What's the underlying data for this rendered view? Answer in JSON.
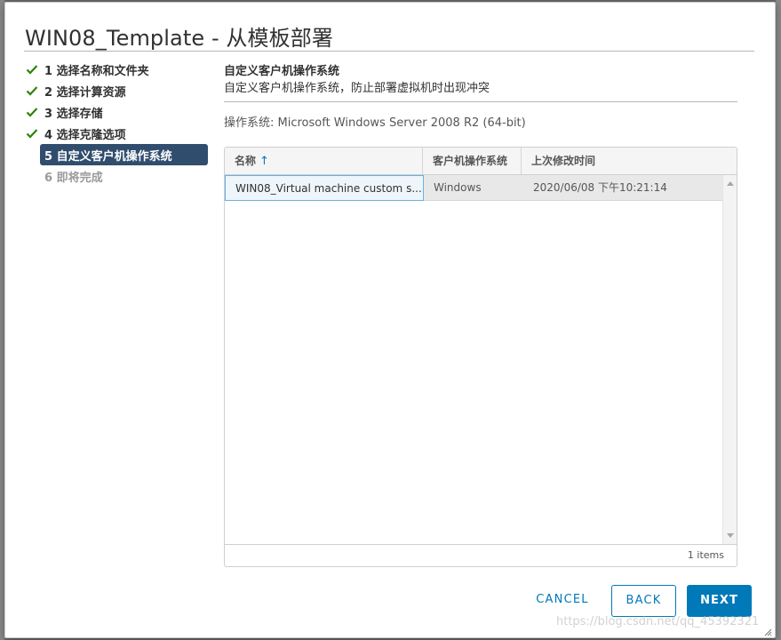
{
  "dialog": {
    "title": "WIN08_Template - 从模板部署"
  },
  "steps": [
    {
      "label": "1 选择名称和文件夹",
      "state": "done"
    },
    {
      "label": "2 选择计算资源",
      "state": "done"
    },
    {
      "label": "3 选择存储",
      "state": "done"
    },
    {
      "label": "4 选择克隆选项",
      "state": "done"
    },
    {
      "label": "5 自定义客户机操作系统",
      "state": "active"
    },
    {
      "label": "6 即将完成",
      "state": "pending"
    }
  ],
  "section": {
    "heading": "自定义客户机操作系统",
    "description": "自定义客户机操作系统，防止部署虚拟机时出现冲突",
    "os_label": "操作系统: Microsoft Windows Server 2008 R2 (64-bit)"
  },
  "grid": {
    "columns": [
      "名称",
      "客户机操作系统",
      "上次修改时间"
    ],
    "sort_icon": "arrow-up-icon",
    "rows": [
      {
        "name": "WIN08_Virtual machine custom s...",
        "guest_os": "Windows",
        "modified": "2020/06/08 下午10:21:14"
      }
    ],
    "footer": "1 items"
  },
  "buttons": {
    "cancel": "CANCEL",
    "back": "BACK",
    "next": "NEXT"
  },
  "watermark": "https://blog.csdn.net/qq_45392321",
  "colors": {
    "accent": "#0079b8",
    "active_step": "#314d6e",
    "check": "#2f8400",
    "selected_border": "#68b2e3"
  }
}
